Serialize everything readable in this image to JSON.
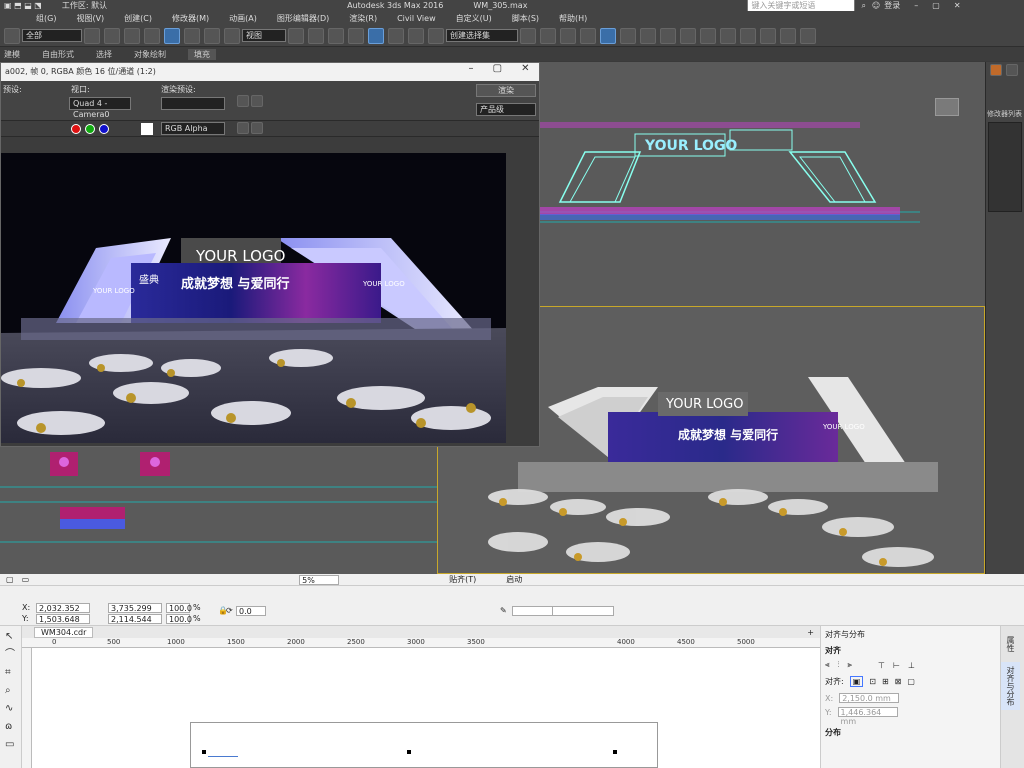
{
  "titlebar": {
    "left_label": "工作区: 默认",
    "app_title": "Autodesk 3ds Max 2016",
    "file_name": "WM_305.max",
    "search_placeholder": "键入关键字或短语",
    "login": "登录"
  },
  "menu": [
    "组(G)",
    "视图(V)",
    "创建(C)",
    "修改器(M)",
    "动画(A)",
    "图形编辑器(D)",
    "渲染(R)",
    "Civil View",
    "自定义(U)",
    "脚本(S)",
    "帮助(H)"
  ],
  "toolbar": {
    "filter_value": "全部",
    "view_value": "视图",
    "selection_set_placeholder": "创建选择集"
  },
  "ribbon": [
    "建模",
    "自由形式",
    "选择",
    "对象绘制",
    "填充"
  ],
  "render_window": {
    "title": "a002, 帧 0, RGBA 颜色 16 位/通道 (1:2)",
    "preset_label": "预设:",
    "viewport_label": "视口:",
    "viewport_value": "Quad 4 - Camera0",
    "render_preset_label": "渲染预设:",
    "render_button": "渲染",
    "product_level": "产品级",
    "channel_value": "RGB Alpha"
  },
  "scene": {
    "logo_text": "YOUR LOGO",
    "banner_title": "成就梦想 与爱同行",
    "banner_side": "盛典",
    "side_logo": "YOUR LOGO"
  },
  "cmdpanel": {
    "modifier_list": "修改器列表"
  },
  "corel": {
    "x_value": "2,032.352 mm",
    "y_value": "1,503.648 mm",
    "w_value": "3,735.299 mm",
    "h_value": "2,114.544 mm",
    "sx_value": "100.0",
    "sy_value": "100.0",
    "pct": "%",
    "angle_value": "0.0",
    "doc_tab": "WM304.cdr",
    "ruler_ticks": [
      "0",
      "500",
      "1000",
      "1500",
      "2000",
      "2500",
      "3000",
      "3500",
      "4000",
      "4500",
      "5000"
    ],
    "zoom_value": "5%",
    "snap_label": "贴齐(T)",
    "launch_label": "启动"
  },
  "align_panel": {
    "title": "对齐与分布",
    "align_heading": "对齐",
    "align_to_label": "对齐:",
    "x_value": "2,150.0 mm",
    "y_value": "1,446.364 mm",
    "distribute_heading": "分布",
    "side_tab_props": "属性",
    "side_tab_align": "对齐与分布"
  }
}
